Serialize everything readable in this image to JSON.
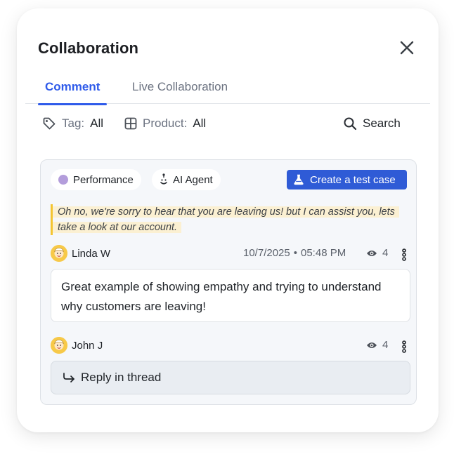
{
  "dialog": {
    "title": "Collaboration"
  },
  "tabs": [
    {
      "label": "Comment",
      "active": true
    },
    {
      "label": "Live Collaboration",
      "active": false
    }
  ],
  "filters": {
    "tag": {
      "label": "Tag:",
      "value": "All"
    },
    "product": {
      "label": "Product:",
      "value": "All"
    },
    "search_label": "Search"
  },
  "card": {
    "chips": [
      {
        "label": "Performance",
        "icon": "purple-dot"
      },
      {
        "label": "AI Agent",
        "icon": "robot-icon"
      }
    ],
    "create_button": {
      "label": "Create a test case",
      "icon": "beaker-icon"
    },
    "quote": "Oh no, we're sorry to hear that you are leaving us! but I can assist you, lets take a look at our account.",
    "comments": [
      {
        "author": "Linda W",
        "date": "10/7/2025",
        "time": "05:48 PM",
        "views": "4",
        "text": "Great example of showing empathy and trying to understand why customers are leaving!"
      }
    ],
    "reply_author": {
      "author": "John J",
      "views": "4"
    },
    "reply_placeholder": "Reply in thread"
  },
  "colors": {
    "accent": "#2f5bea",
    "button": "#2f5bd6",
    "quote_border": "#f4c531",
    "quote_highlight": "#fbf0d2",
    "performance_dot": "#b39ddb"
  }
}
